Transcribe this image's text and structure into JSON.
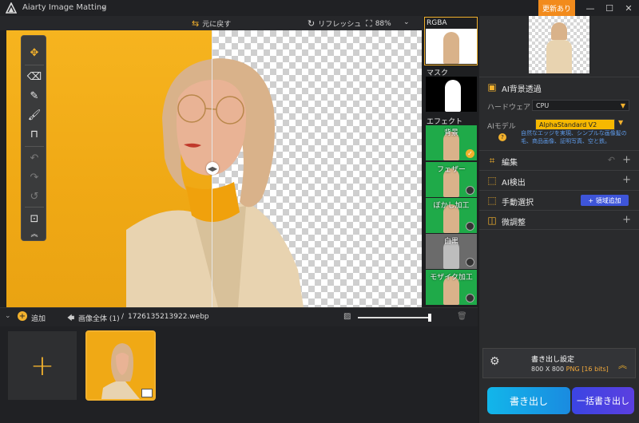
{
  "titlebar": {
    "app_title": "Aiarty Image Matting",
    "update_label": "更新あり",
    "minimize": "—",
    "maximize": "☐",
    "close": "✕"
  },
  "toolbar": {
    "undo_label": "元に戻す",
    "refresh_label": "リフレッシュ",
    "zoom": "88%"
  },
  "thumbs": {
    "rgba_label": "RGBA",
    "mask_label": "マスク",
    "effect_label": "エフェクト",
    "effects": [
      {
        "label": "背景",
        "checked": true
      },
      {
        "label": "フェザー",
        "checked": false
      },
      {
        "label": "ぼかし加工",
        "checked": false
      },
      {
        "label": "白黒",
        "checked": false
      },
      {
        "label": "モザイク加工",
        "checked": false
      }
    ]
  },
  "rpanel": {
    "ai_bg_title": "AI背景透過",
    "hardware_label": "ハードウェア",
    "hardware_value": "CPU",
    "ai_model_label": "AIモデル",
    "ai_model_value": "AlphaStandard  V2",
    "model_desc": "自然なエッジを実現、シンプルな画像髪の毛、商品画像、証明写真、空と鉄。",
    "sections": [
      {
        "label": "編集"
      },
      {
        "label": "AI検出"
      },
      {
        "label": "手動選択"
      },
      {
        "label": "微調整"
      }
    ],
    "add_region_label": "+ 領域追加"
  },
  "export": {
    "title": "書き出し設定",
    "size": "800 X 800",
    "format": "PNG",
    "bits": "[16 bits]",
    "export_label": "書き出し",
    "batch_label": "一括書き出し"
  },
  "bottom": {
    "add_label": "追加",
    "breadcrumb_all": "画像全体 (1)",
    "separator": "/",
    "filename": "1726135213922.webp",
    "slider_value": 0.98
  },
  "colors": {
    "accent": "#f2b12d",
    "update": "#f28b1c",
    "export_blue": "#12b6ea",
    "batch_purple": "#3b45e3",
    "canvas_bg": "#f6b41f",
    "effect_green": "#1faa49"
  }
}
